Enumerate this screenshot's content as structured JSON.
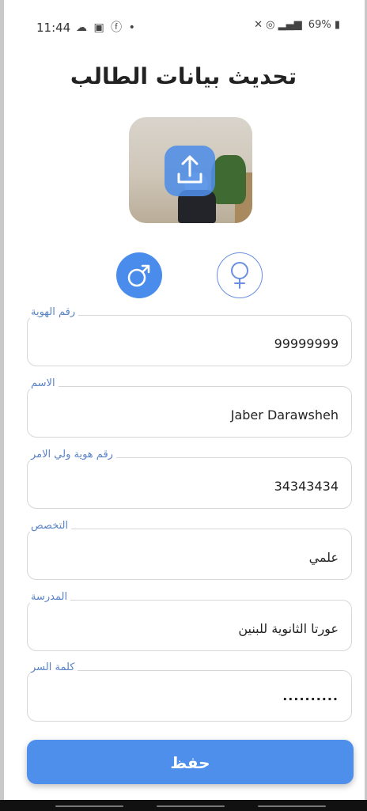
{
  "status_bar": {
    "time": "11:44",
    "left_icons": [
      "cloud-icon",
      "image-icon",
      "facebook-icon",
      "dot-icon"
    ],
    "right_icons": [
      "mute-icon",
      "hotspot-icon",
      "data-icon",
      "signal-icon"
    ],
    "battery": "69%"
  },
  "page_title": "تحديث بيانات الطالب",
  "photo": {
    "upload_icon": "upload-icon"
  },
  "gender": {
    "selected": "male",
    "male_icon": "male-icon",
    "female_icon": "female-icon"
  },
  "fields": [
    {
      "label": "رقم الهوية",
      "value": "99999999"
    },
    {
      "label": "الاسم",
      "value": "Jaber Darawsheh"
    },
    {
      "label": "رقم هوية ولي الامر",
      "value": "34343434"
    },
    {
      "label": "التخصص",
      "value": "علمي"
    },
    {
      "label": "المدرسة",
      "value": "عورتا الثانوية للبنين"
    },
    {
      "label": "كلمة السر",
      "value": ".........."
    }
  ],
  "save_label": "حفظ",
  "colors": {
    "accent": "#4f8fec",
    "label": "#5a83c8"
  }
}
